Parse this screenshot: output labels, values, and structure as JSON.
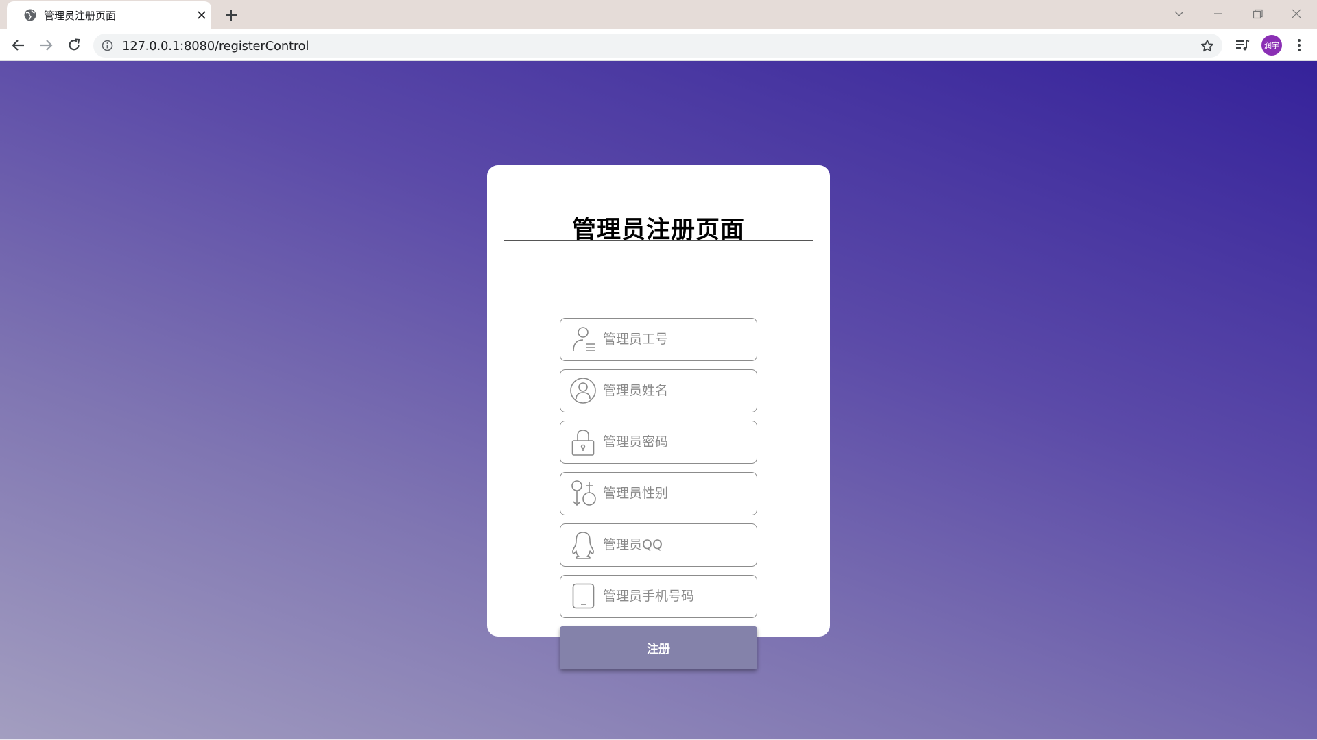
{
  "browser": {
    "tab": {
      "title": "管理员注册页面",
      "favicon": "globe-icon",
      "close_icon": "close-icon"
    },
    "new_tab_icon": "plus-icon",
    "window_controls": [
      "chevron-down-icon",
      "minimize-icon",
      "restore-icon",
      "close-icon"
    ],
    "address_bar": {
      "url": "127.0.0.1:8080/registerControl",
      "info_icon": "info-icon",
      "bookmark_icon": "star-icon"
    },
    "profile": {
      "label": "润宇",
      "color": "#8a2fb4"
    }
  },
  "page": {
    "title": "管理员注册页面",
    "fields": [
      {
        "icon": "user-list-icon",
        "placeholder": "管理员工号",
        "value": ""
      },
      {
        "icon": "user-circle-icon",
        "placeholder": "管理员姓名",
        "value": ""
      },
      {
        "icon": "lock-icon",
        "placeholder": "管理员密码",
        "value": ""
      },
      {
        "icon": "gender-icon",
        "placeholder": "管理员性别",
        "value": ""
      },
      {
        "icon": "qq-penguin-icon",
        "placeholder": "管理员QQ",
        "value": ""
      },
      {
        "icon": "mobile-phone-icon",
        "placeholder": "管理员手机号码",
        "value": ""
      }
    ],
    "submit_label": "注册",
    "colors": {
      "background_gradient": [
        "#35229a",
        "#a39ec0"
      ],
      "button": "#8482aa"
    }
  }
}
